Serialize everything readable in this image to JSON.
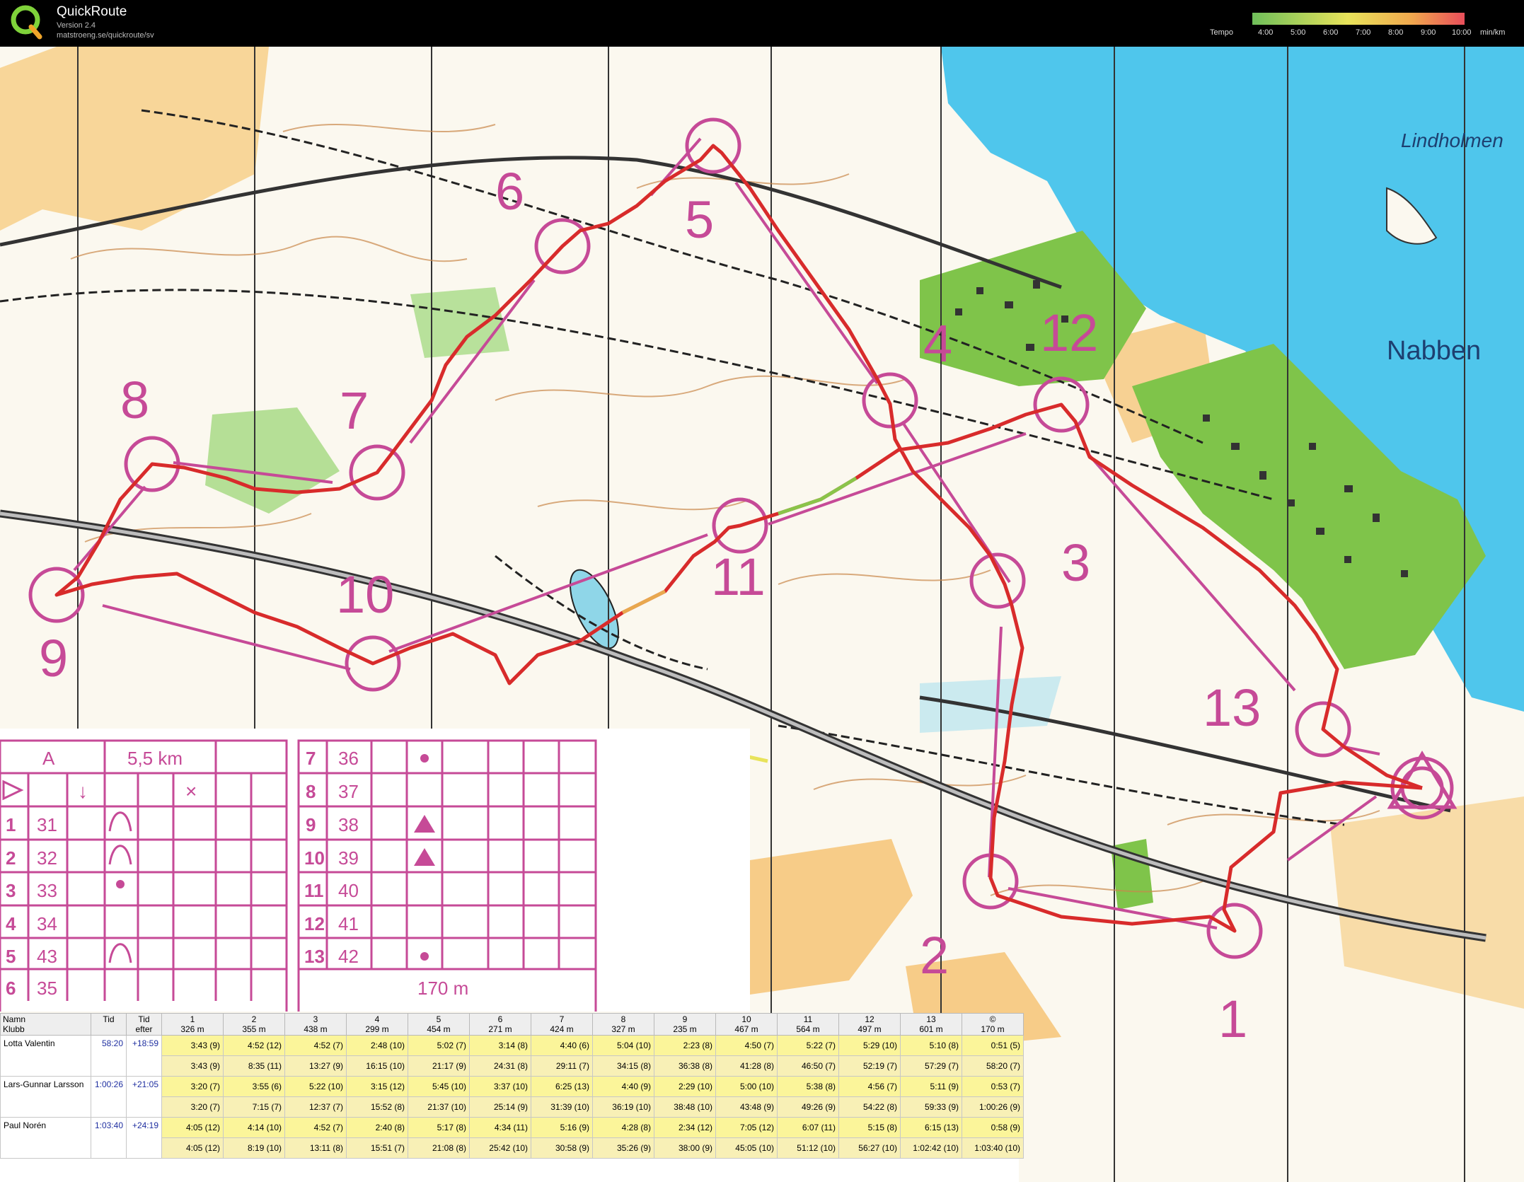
{
  "app": {
    "title": "QuickRoute",
    "version": "Version 2.4",
    "url": "matstroeng.se/quickroute/sv",
    "tempo_label": "Tempo",
    "tempo_ticks": [
      "4:00",
      "5:00",
      "6:00",
      "7:00",
      "8:00",
      "9:00",
      "10:00"
    ],
    "tempo_unit": "min/km"
  },
  "map": {
    "place_names": [
      "Lindholmen",
      "Nabben"
    ],
    "controls": [
      "1",
      "2",
      "3",
      "4",
      "5",
      "6",
      "7",
      "8",
      "9",
      "10",
      "11",
      "12",
      "13"
    ],
    "colors": {
      "water": "#4fc6ec",
      "route": "#d82b2b",
      "course": "#c64a97",
      "vegetation": "#7fc44a",
      "open": "#f7c97a"
    }
  },
  "control_card": {
    "class": "A",
    "distance": "5,5 km",
    "finish_distance": "170 m",
    "rows_left": [
      {
        "num": "1",
        "code": "31"
      },
      {
        "num": "2",
        "code": "32"
      },
      {
        "num": "3",
        "code": "33"
      },
      {
        "num": "4",
        "code": "34"
      },
      {
        "num": "5",
        "code": "43"
      },
      {
        "num": "6",
        "code": "35"
      }
    ],
    "rows_right": [
      {
        "num": "7",
        "code": "36"
      },
      {
        "num": "8",
        "code": "37"
      },
      {
        "num": "9",
        "code": "38"
      },
      {
        "num": "10",
        "code": "39"
      },
      {
        "num": "11",
        "code": "40"
      },
      {
        "num": "12",
        "code": "41"
      },
      {
        "num": "13",
        "code": "42"
      }
    ]
  },
  "results": {
    "headers": {
      "name": "Namn",
      "club": "Klubb",
      "time": "Tid",
      "behind": "Tid efter",
      "controls": [
        "1",
        "2",
        "3",
        "4",
        "5",
        "6",
        "7",
        "8",
        "9",
        "10",
        "11",
        "12",
        "13",
        "©"
      ],
      "distances": [
        "326 m",
        "355 m",
        "438 m",
        "299 m",
        "454 m",
        "271 m",
        "424 m",
        "327 m",
        "235 m",
        "467 m",
        "564 m",
        "497 m",
        "601 m",
        "170 m"
      ]
    },
    "runners": [
      {
        "name": "Lotta Valentin",
        "time": "58:20",
        "behind": "+18:59",
        "legs": [
          "3:43 (9)",
          "4:52 (12)",
          "4:52 (7)",
          "2:48 (10)",
          "5:02 (7)",
          "3:14 (8)",
          "4:40 (6)",
          "5:04 (10)",
          "2:23 (8)",
          "4:50 (7)",
          "5:22 (7)",
          "5:29 (10)",
          "5:10 (8)",
          "0:51 (5)"
        ],
        "cum": [
          "3:43 (9)",
          "8:35 (11)",
          "13:27 (9)",
          "16:15 (10)",
          "21:17 (9)",
          "24:31 (8)",
          "29:11 (7)",
          "34:15 (8)",
          "36:38 (8)",
          "41:28 (8)",
          "46:50 (7)",
          "52:19 (7)",
          "57:29 (7)",
          "58:20 (7)"
        ]
      },
      {
        "name": "Lars-Gunnar Larsson",
        "time": "1:00:26",
        "behind": "+21:05",
        "legs": [
          "3:20 (7)",
          "3:55 (6)",
          "5:22 (10)",
          "3:15 (12)",
          "5:45 (10)",
          "3:37 (10)",
          "6:25 (13)",
          "4:40 (9)",
          "2:29 (10)",
          "5:00 (10)",
          "5:38 (8)",
          "4:56 (7)",
          "5:11 (9)",
          "0:53 (7)"
        ],
        "cum": [
          "3:20 (7)",
          "7:15 (7)",
          "12:37 (7)",
          "15:52 (8)",
          "21:37 (10)",
          "25:14 (9)",
          "31:39 (10)",
          "36:19 (10)",
          "38:48 (10)",
          "43:48 (9)",
          "49:26 (9)",
          "54:22 (8)",
          "59:33 (9)",
          "1:00:26 (9)"
        ]
      },
      {
        "name": "Paul Norén",
        "time": "1:03:40",
        "behind": "+24:19",
        "legs": [
          "4:05 (12)",
          "4:14 (10)",
          "4:52 (7)",
          "2:40 (8)",
          "5:17 (8)",
          "4:34 (11)",
          "5:16 (9)",
          "4:28 (8)",
          "2:34 (12)",
          "7:05 (12)",
          "6:07 (11)",
          "5:15 (8)",
          "6:15 (13)",
          "0:58 (9)"
        ],
        "cum": [
          "4:05 (12)",
          "8:19 (10)",
          "13:11 (8)",
          "15:51 (7)",
          "21:08 (8)",
          "25:42 (10)",
          "30:58 (9)",
          "35:26 (9)",
          "38:00 (9)",
          "45:05 (10)",
          "51:12 (10)",
          "56:27 (10)",
          "1:02:42 (10)",
          "1:03:40 (10)"
        ]
      }
    ]
  }
}
